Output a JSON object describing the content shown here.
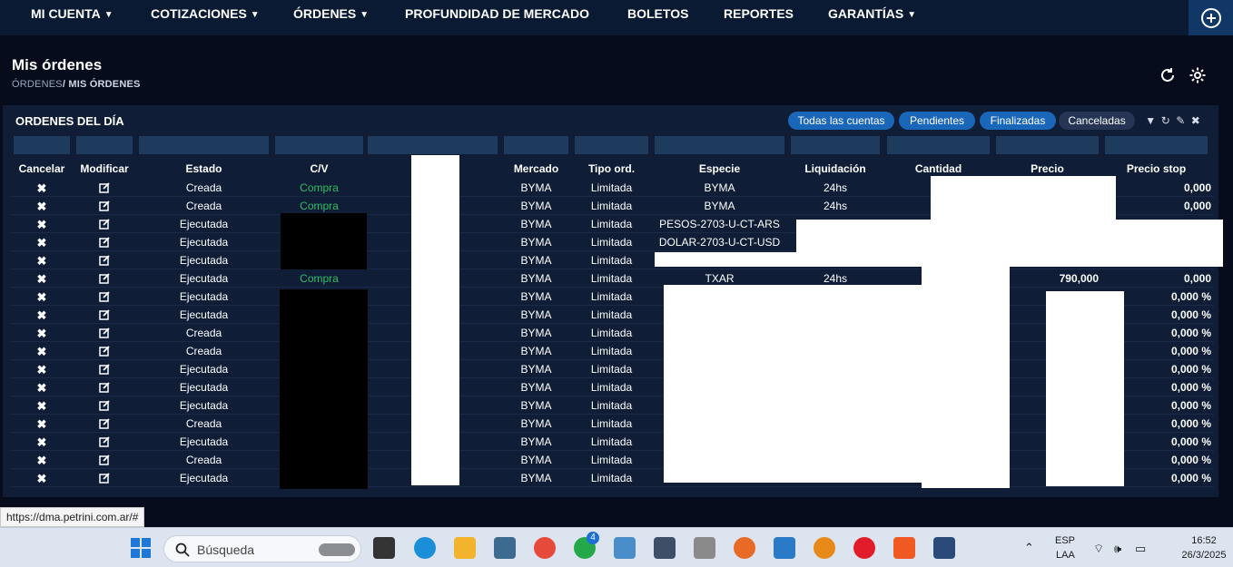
{
  "nav": {
    "items": [
      {
        "label": "MI CUENTA",
        "dropdown": true
      },
      {
        "label": "COTIZACIONES",
        "dropdown": true
      },
      {
        "label": "ÓRDENES",
        "dropdown": true
      },
      {
        "label": "PROFUNDIDAD DE MERCADO",
        "dropdown": false
      },
      {
        "label": "BOLETOS",
        "dropdown": false
      },
      {
        "label": "REPORTES",
        "dropdown": false
      },
      {
        "label": "GARANTÍAS",
        "dropdown": true
      }
    ],
    "add_icon": "plus-circle-icon"
  },
  "page": {
    "title": "Mis órdenes",
    "breadcrumb_parent": "ÓRDENES",
    "breadcrumb_sep": "/",
    "breadcrumb_current": "MIS ÓRDENES"
  },
  "panel": {
    "title": "ORDENES DEL DÍA",
    "filters": [
      {
        "label": "Todas las cuentas",
        "active": true
      },
      {
        "label": "Pendientes",
        "active": true
      },
      {
        "label": "Finalizadas",
        "active": true
      },
      {
        "label": "Canceladas",
        "active": false
      }
    ]
  },
  "table": {
    "columns": [
      "Cancelar",
      "Modificar",
      "Estado",
      "C/V",
      "",
      "Mercado",
      "Tipo ord.",
      "Especie",
      "Liquidación",
      "Cantidad",
      "Precio",
      "Precio stop"
    ],
    "rows": [
      {
        "estado": "Creada",
        "cv": "Compra",
        "mercado": "BYMA",
        "tipo": "Limitada",
        "especie": "BYMA",
        "liquidacion": "24hs",
        "precio": "",
        "stop": "0,000"
      },
      {
        "estado": "Creada",
        "cv": "Compra",
        "mercado": "BYMA",
        "tipo": "Limitada",
        "especie": "BYMA",
        "liquidacion": "24hs",
        "precio": "",
        "stop": "0,000"
      },
      {
        "estado": "Ejecutada",
        "cv": "",
        "mercado": "BYMA",
        "tipo": "Limitada",
        "especie": "PESOS-2703-U-CT-ARS",
        "liquidacion": "",
        "precio": "",
        "stop": ""
      },
      {
        "estado": "Ejecutada",
        "cv": "",
        "mercado": "BYMA",
        "tipo": "Limitada",
        "especie": "DOLAR-2703-U-CT-USD",
        "liquidacion": "",
        "precio": "",
        "stop": ""
      },
      {
        "estado": "Ejecutada",
        "cv": "",
        "mercado": "BYMA",
        "tipo": "Limitada",
        "especie": "",
        "liquidacion": "",
        "precio": "",
        "stop": ""
      },
      {
        "estado": "Ejecutada",
        "cv": "Compra",
        "mercado": "BYMA",
        "tipo": "Limitada",
        "especie": "TXAR",
        "liquidacion": "24hs",
        "precio": "790,000",
        "stop": "0,000"
      },
      {
        "estado": "Ejecutada",
        "cv": "",
        "mercado": "BYMA",
        "tipo": "Limitada",
        "especie": "",
        "liquidacion": "",
        "precio": "",
        "stop": "0,000 %"
      },
      {
        "estado": "Ejecutada",
        "cv": "",
        "mercado": "BYMA",
        "tipo": "Limitada",
        "especie": "",
        "liquidacion": "",
        "precio": "",
        "stop": "0,000 %"
      },
      {
        "estado": "Creada",
        "cv": "",
        "mercado": "BYMA",
        "tipo": "Limitada",
        "especie": "",
        "liquidacion": "",
        "precio": "",
        "stop": "0,000 %"
      },
      {
        "estado": "Creada",
        "cv": "",
        "mercado": "BYMA",
        "tipo": "Limitada",
        "especie": "",
        "liquidacion": "",
        "precio": "",
        "stop": "0,000 %"
      },
      {
        "estado": "Ejecutada",
        "cv": "",
        "mercado": "BYMA",
        "tipo": "Limitada",
        "especie": "",
        "liquidacion": "",
        "precio": "",
        "stop": "0,000 %"
      },
      {
        "estado": "Ejecutada",
        "cv": "",
        "mercado": "BYMA",
        "tipo": "Limitada",
        "especie": "",
        "liquidacion": "",
        "precio": "",
        "stop": "0,000 %"
      },
      {
        "estado": "Ejecutada",
        "cv": "",
        "mercado": "BYMA",
        "tipo": "Limitada",
        "especie": "",
        "liquidacion": "",
        "precio": "",
        "stop": "0,000 %"
      },
      {
        "estado": "Creada",
        "cv": "",
        "mercado": "BYMA",
        "tipo": "Limitada",
        "especie": "",
        "liquidacion": "",
        "precio": "",
        "stop": "0,000 %"
      },
      {
        "estado": "Ejecutada",
        "cv": "",
        "mercado": "BYMA",
        "tipo": "Limitada",
        "especie": "",
        "liquidacion": "",
        "precio": "",
        "stop": "0,000 %"
      },
      {
        "estado": "Creada",
        "cv": "",
        "mercado": "BYMA",
        "tipo": "Limitada",
        "especie": "",
        "liquidacion": "",
        "precio": "",
        "stop": "0,000 %"
      },
      {
        "estado": "Ejecutada",
        "cv": "",
        "mercado": "BYMA",
        "tipo": "Limitada",
        "especie": "",
        "liquidacion": "",
        "precio": "",
        "stop": "0,000 %"
      }
    ]
  },
  "status_url": "https://dma.petrini.com.ar/#",
  "taskbar": {
    "search_placeholder": "Búsqueda",
    "whatsapp_badge": "4",
    "lang": "ESP",
    "lang_sub": "LAA",
    "time": "16:52",
    "date": "26/3/2025"
  },
  "colors": {
    "background": "#070c1d",
    "nav": "#0b1a33",
    "panel": "#0f1d36",
    "accent": "#1a66b8",
    "buy": "#2bbf63"
  }
}
